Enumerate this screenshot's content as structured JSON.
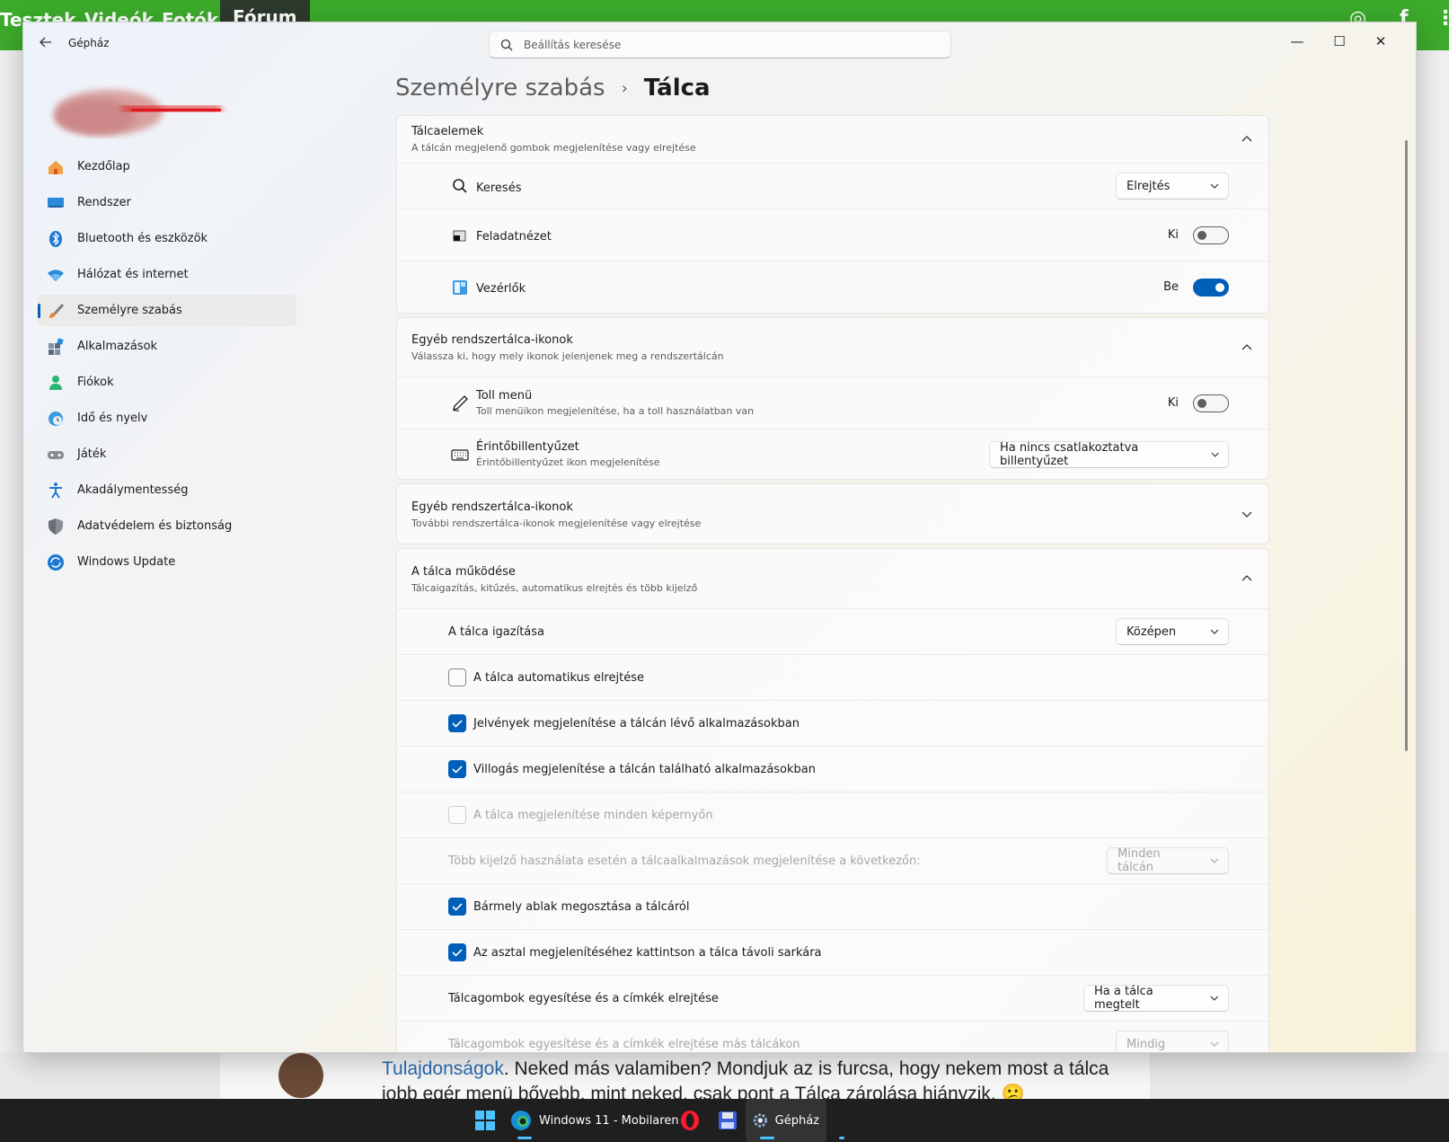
{
  "background": {
    "nav": [
      "Tesztek",
      "Videók",
      "Fotók",
      "Fórum"
    ],
    "social": [
      "instagram-icon",
      "facebook-icon",
      "more-icon"
    ],
    "post_link": "Tulajdonságok",
    "post_text": ". Neked más valamiben? Mondjuk az is furcsa, hogy nekem most a tálca jobb egér menü bővebb, mint neked, csak pont a Tálca zárolása hiányzik. 😕"
  },
  "taskbar": {
    "items": [
      {
        "icon": "windows-start-icon",
        "label": ""
      },
      {
        "icon": "edge-icon",
        "label": "Windows 11 - Mobilaren"
      },
      {
        "icon": "opera-icon",
        "label": ""
      },
      {
        "icon": "floppy-icon",
        "label": ""
      },
      {
        "icon": "settings-gear-icon",
        "label": "Gépház"
      }
    ]
  },
  "window": {
    "title": "Gépház",
    "search_placeholder": "Beállítás keresése",
    "controls": {
      "minimize": "—",
      "maximize": "☐",
      "close": "✕"
    }
  },
  "sidebar": {
    "items": [
      {
        "label": "Kezdőlap",
        "icon": "home-icon",
        "selected": false
      },
      {
        "label": "Rendszer",
        "icon": "system-monitor-icon",
        "selected": false
      },
      {
        "label": "Bluetooth és eszközök",
        "icon": "bluetooth-icon",
        "selected": false
      },
      {
        "label": "Hálózat és internet",
        "icon": "wifi-icon",
        "selected": false
      },
      {
        "label": "Személyre szabás",
        "icon": "brush-icon",
        "selected": true
      },
      {
        "label": "Alkalmazások",
        "icon": "apps-icon",
        "selected": false
      },
      {
        "label": "Fiókok",
        "icon": "account-icon",
        "selected": false
      },
      {
        "label": "Idő és nyelv",
        "icon": "globe-clock-icon",
        "selected": false
      },
      {
        "label": "Játék",
        "icon": "gamepad-icon",
        "selected": false
      },
      {
        "label": "Akadálymentesség",
        "icon": "accessibility-icon",
        "selected": false
      },
      {
        "label": "Adatvédelem és biztonság",
        "icon": "shield-icon",
        "selected": false
      },
      {
        "label": "Windows Update",
        "icon": "update-icon",
        "selected": false
      }
    ]
  },
  "header": {
    "parent": "Személyre szabás",
    "separator": "›",
    "current": "Tálca"
  },
  "sections": {
    "taskbar_items": {
      "title": "Tálcaelemek",
      "subtitle": "A tálcán megjelenő gombok megjelenítése vagy elrejtése",
      "rows": [
        {
          "label": "Keresés",
          "icon": "search-icon",
          "control": "dropdown",
          "value": "Elrejtés"
        },
        {
          "label": "Feladatnézet",
          "icon": "task-view-icon",
          "control": "toggle",
          "state_label": "Ki",
          "on": false
        },
        {
          "label": "Vezérlők",
          "icon": "widgets-icon",
          "control": "toggle",
          "state_label": "Be",
          "on": true
        }
      ]
    },
    "system_tray_icons": {
      "title": "Egyéb rendszertálca-ikonok",
      "subtitle": "Válassza ki, hogy mely ikonok jelenjenek meg a rendszertálcán",
      "rows": [
        {
          "label": "Toll menü",
          "desc": "Toll menüikon megjelenítése, ha a toll használatban van",
          "icon": "pen-icon",
          "state_label": "Ki",
          "on": false
        },
        {
          "label": "Érintőbillentyűzet",
          "desc": "Érintőbillentyűzet ikon megjelenítése",
          "icon": "keyboard-icon",
          "value": "Ha nincs csatlakoztatva billentyűzet"
        }
      ]
    },
    "other_tray_icons": {
      "title": "Egyéb rendszertálca-ikonok",
      "subtitle": "További rendszertálca-ikonok megjelenítése vagy elrejtése"
    },
    "behaviors": {
      "title": "A tálca működése",
      "subtitle": "Tálcaigazítás, kitűzés, automatikus elrejtés és több kijelző",
      "alignment": {
        "label": "A tálca igazítása",
        "value": "Középen"
      },
      "checkboxes": [
        {
          "label": "A tálca automatikus elrejtése",
          "checked": false,
          "disabled": false
        },
        {
          "label": "Jelvények megjelenítése a tálcán lévő alkalmazásokban",
          "checked": true,
          "disabled": false
        },
        {
          "label": "Villogás megjelenítése a tálcán található alkalmazásokban",
          "checked": true,
          "disabled": false
        },
        {
          "label": "A tálca megjelenítése minden képernyőn",
          "checked": false,
          "disabled": true
        }
      ],
      "multi_display": {
        "label": "Több kijelző használata esetén a tálcaalkalmazások megjelenítése a következőn:",
        "value": "Minden tálcán"
      },
      "checkboxes2": [
        {
          "label": "Bármely ablak megosztása a tálcáról",
          "checked": true
        },
        {
          "label": "Az asztal megjelenítéséhez kattintson a tálca távoli sarkára",
          "checked": true
        }
      ],
      "combine": {
        "label": "Tálcagombok egyesítése és a címkék elrejtése",
        "value": "Ha a tálca megtelt"
      },
      "combine_other": {
        "label": "Tálcagombok egyesítése és a címkék elrejtése más tálcákon",
        "value": "Mindig"
      }
    }
  },
  "colors": {
    "accent": "#005fb8",
    "brand_green": "#3cab2b"
  }
}
